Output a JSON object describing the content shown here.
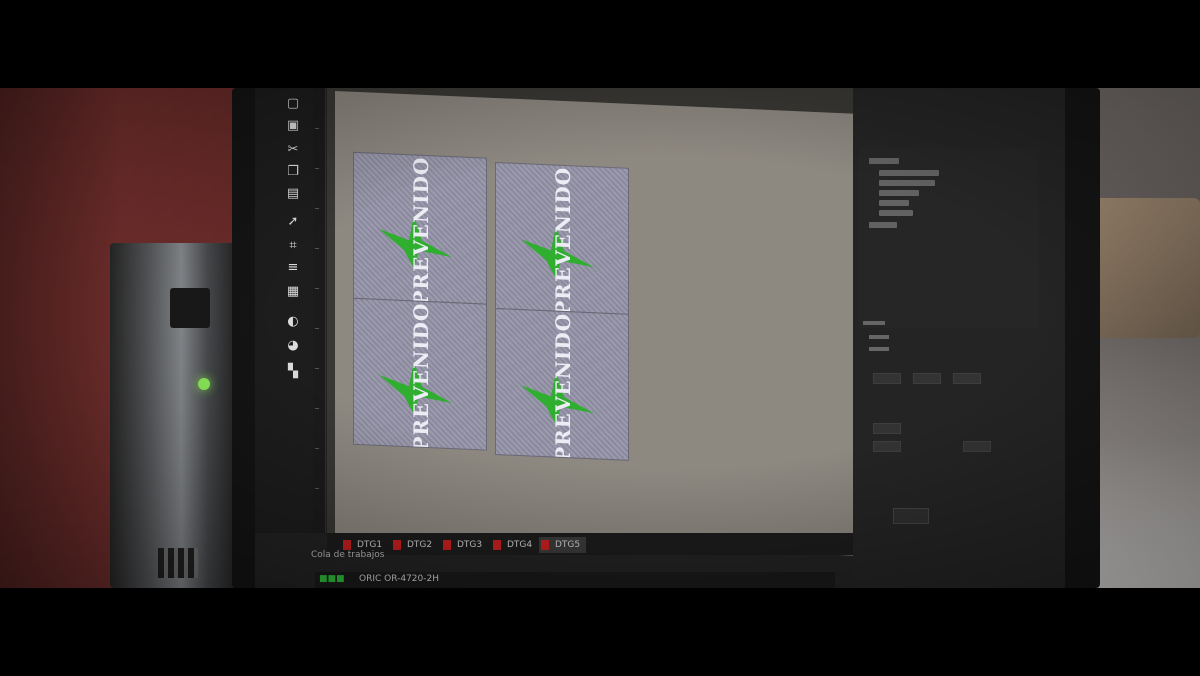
{
  "canvas": {
    "tiles": [
      {
        "text": "PREVENIDO"
      },
      {
        "text": "PREVENIDO"
      },
      {
        "text": "PREVENIDO"
      },
      {
        "text": "PREVENIDO"
      }
    ]
  },
  "tabs": [
    {
      "label": "DTG1",
      "active": false
    },
    {
      "label": "DTG2",
      "active": false
    },
    {
      "label": "DTG3",
      "active": false
    },
    {
      "label": "DTG4",
      "active": false
    },
    {
      "label": "DTG5",
      "active": true
    }
  ],
  "queue": {
    "title": "Cola de trabajos",
    "printer_name": "ORIC OR-4720-2H"
  },
  "colors": {
    "logo_green": "#2fae2f",
    "tab_dot": "#c81f1f",
    "led": "#8ef05a"
  }
}
